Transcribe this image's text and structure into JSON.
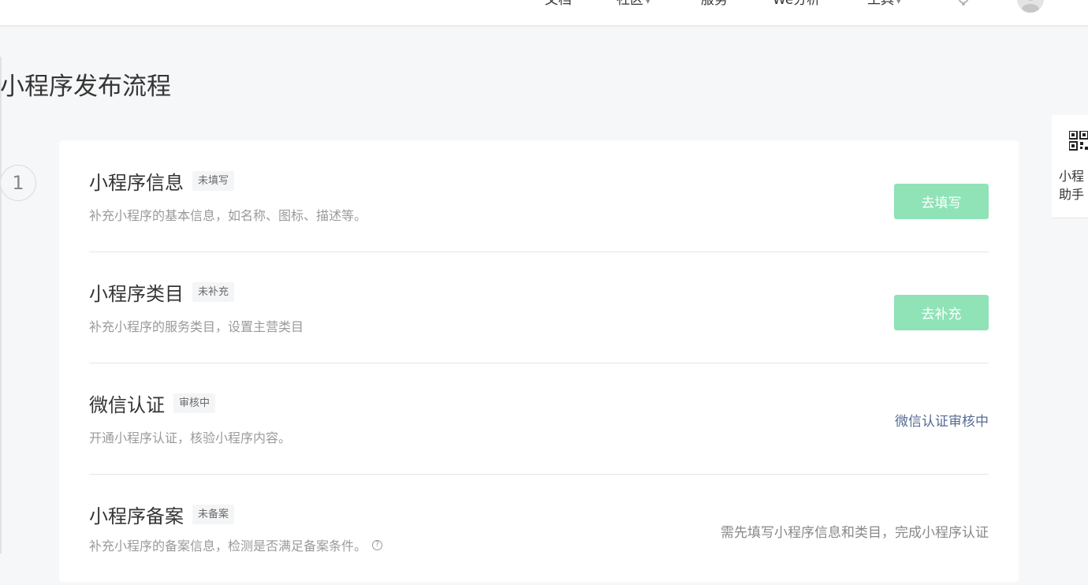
{
  "nav": {
    "items": [
      {
        "label": "文档",
        "has_caret": false
      },
      {
        "label": "社区",
        "has_caret": true
      },
      {
        "label": "服务",
        "has_caret": false
      },
      {
        "label": "We分析",
        "has_caret": false
      },
      {
        "label": "工具",
        "has_caret": true
      }
    ],
    "icons": [
      "bell-icon",
      "avatar-icon"
    ]
  },
  "page": {
    "title": "小程序发布流程",
    "step_number": "1"
  },
  "tasks": [
    {
      "title": "小程序信息",
      "badge": "未填写",
      "desc": "补充小程序的基本信息，如名称、图标、描述等。",
      "action_type": "button",
      "action_label": "去填写"
    },
    {
      "title": "小程序类目",
      "badge": "未补充",
      "desc": "补充小程序的服务类目，设置主营类目",
      "action_type": "button",
      "action_label": "去补充"
    },
    {
      "title": "微信认证",
      "badge": "审核中",
      "desc": "开通小程序认证，核验小程序内容。",
      "action_type": "status",
      "action_label": "微信认证审核中"
    },
    {
      "title": "小程序备案",
      "badge": "未备案",
      "desc": "补充小程序的备案信息，检测是否满足备案条件。",
      "action_type": "status",
      "action_label": "需先填写小程序信息和类目，完成小程序认证",
      "has_help_icon": true
    }
  ],
  "float_panel": {
    "label_line1": "小程",
    "label_line2": "助手",
    "icon": "qr-code-icon"
  },
  "colors": {
    "primary_disabled": "#8fe3b7",
    "link": "#576b95",
    "muted": "#9a9a9a",
    "background": "#f6f7f9"
  }
}
